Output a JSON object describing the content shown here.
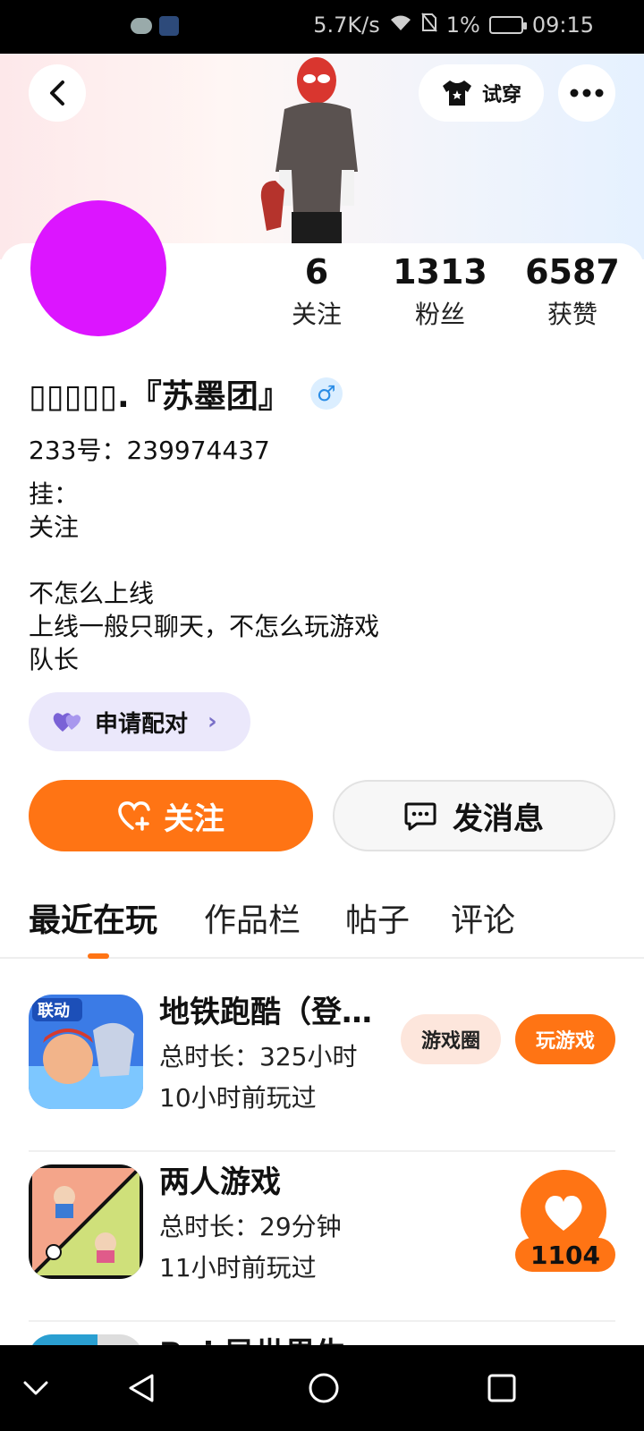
{
  "status_bar": {
    "speed": "5.7K/s",
    "battery": "1%",
    "time": "09:15"
  },
  "header": {
    "try_on_label": "试穿"
  },
  "stats": [
    {
      "value": "6",
      "label": "关注"
    },
    {
      "value": "1313",
      "label": "粉丝"
    },
    {
      "value": "6587",
      "label": "获赞"
    }
  ],
  "profile": {
    "nickname": "▯▯▯▯▯.『苏墨团』",
    "gender_symbol": "♂",
    "uid": "233号：239974437",
    "bio_lines": [
      "挂：",
      "关注",
      "",
      "不怎么上线",
      "上线一般只聊天，不怎么玩游戏",
      "队长"
    ]
  },
  "pair_button": "申请配对",
  "actions": {
    "follow": "关注",
    "message": "发消息"
  },
  "tabs": [
    "最近在玩",
    "作品栏",
    "帖子",
    "评论"
  ],
  "games": [
    {
      "title": "地铁跑酷（登…",
      "duration": "总时长：325小时",
      "last_played": "10小时前玩过",
      "circle_label": "游戏圈",
      "play_label": "玩游戏"
    },
    {
      "title": "两人游戏",
      "duration": "总时长：29分钟",
      "last_played": "11小时前玩过"
    },
    {
      "title": "Pui 异世界生"
    }
  ],
  "like_badge": {
    "count": "1104"
  },
  "colors": {
    "accent": "#ff7414",
    "avatar": "#dc15ff"
  }
}
